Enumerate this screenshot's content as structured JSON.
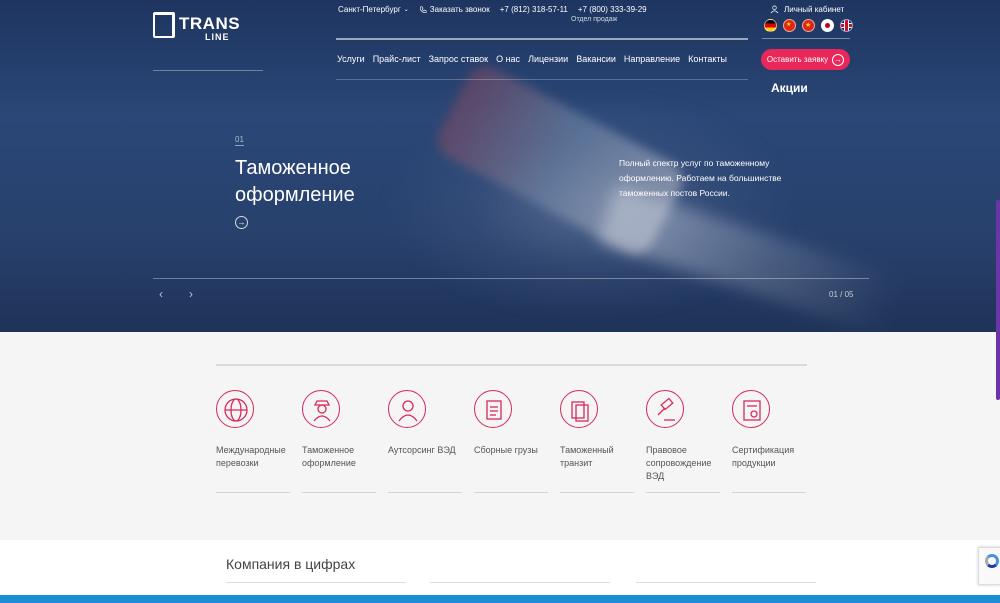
{
  "header": {
    "logo_top": "TRANS",
    "logo_bottom": "LINE",
    "city": "Санкт-Петербург",
    "callback": "Заказать звонок",
    "phone1": "+7 (812) 318-57-11",
    "phone2": "+7 (800) 333-39-29",
    "sales_label": "Отдел продаж",
    "cabinet": "Личный кабинет",
    "cta": "Оставить заявку",
    "promo": "Акции",
    "languages": [
      "de",
      "cn",
      "vn",
      "jp",
      "gb"
    ]
  },
  "nav": [
    "Услуги",
    "Прайс-лист",
    "Запрос ставок",
    "О нас",
    "Лицензии",
    "Вакансии",
    "Направление",
    "Контакты"
  ],
  "slider": {
    "number": "01",
    "title": "Таможенное оформление",
    "description": "Полный спектр услуг по таможенному оформлению. Работаем на большинстве таможенных постов России.",
    "counter": "01 / 05",
    "prev_icon": "‹",
    "next_icon": "›"
  },
  "services": [
    {
      "label": "Международные перевозки",
      "icon": "globe-icon"
    },
    {
      "label": "Таможенное оформление",
      "icon": "customs-officer-icon"
    },
    {
      "label": "Аутсорсинг ВЭД",
      "icon": "person-icon"
    },
    {
      "label": "Сборные грузы",
      "icon": "clipboard-icon"
    },
    {
      "label": "Таможенный транзит",
      "icon": "documents-icon"
    },
    {
      "label": "Правовое сопровождение ВЭД",
      "icon": "gavel-icon"
    },
    {
      "label": "Сертификация продукции",
      "icon": "certificate-icon"
    }
  ],
  "company": {
    "title": "Компания в цифрах"
  },
  "colors": {
    "accent": "#e8285a",
    "icon_stroke": "#d82a5b",
    "hero": "#28416d"
  }
}
